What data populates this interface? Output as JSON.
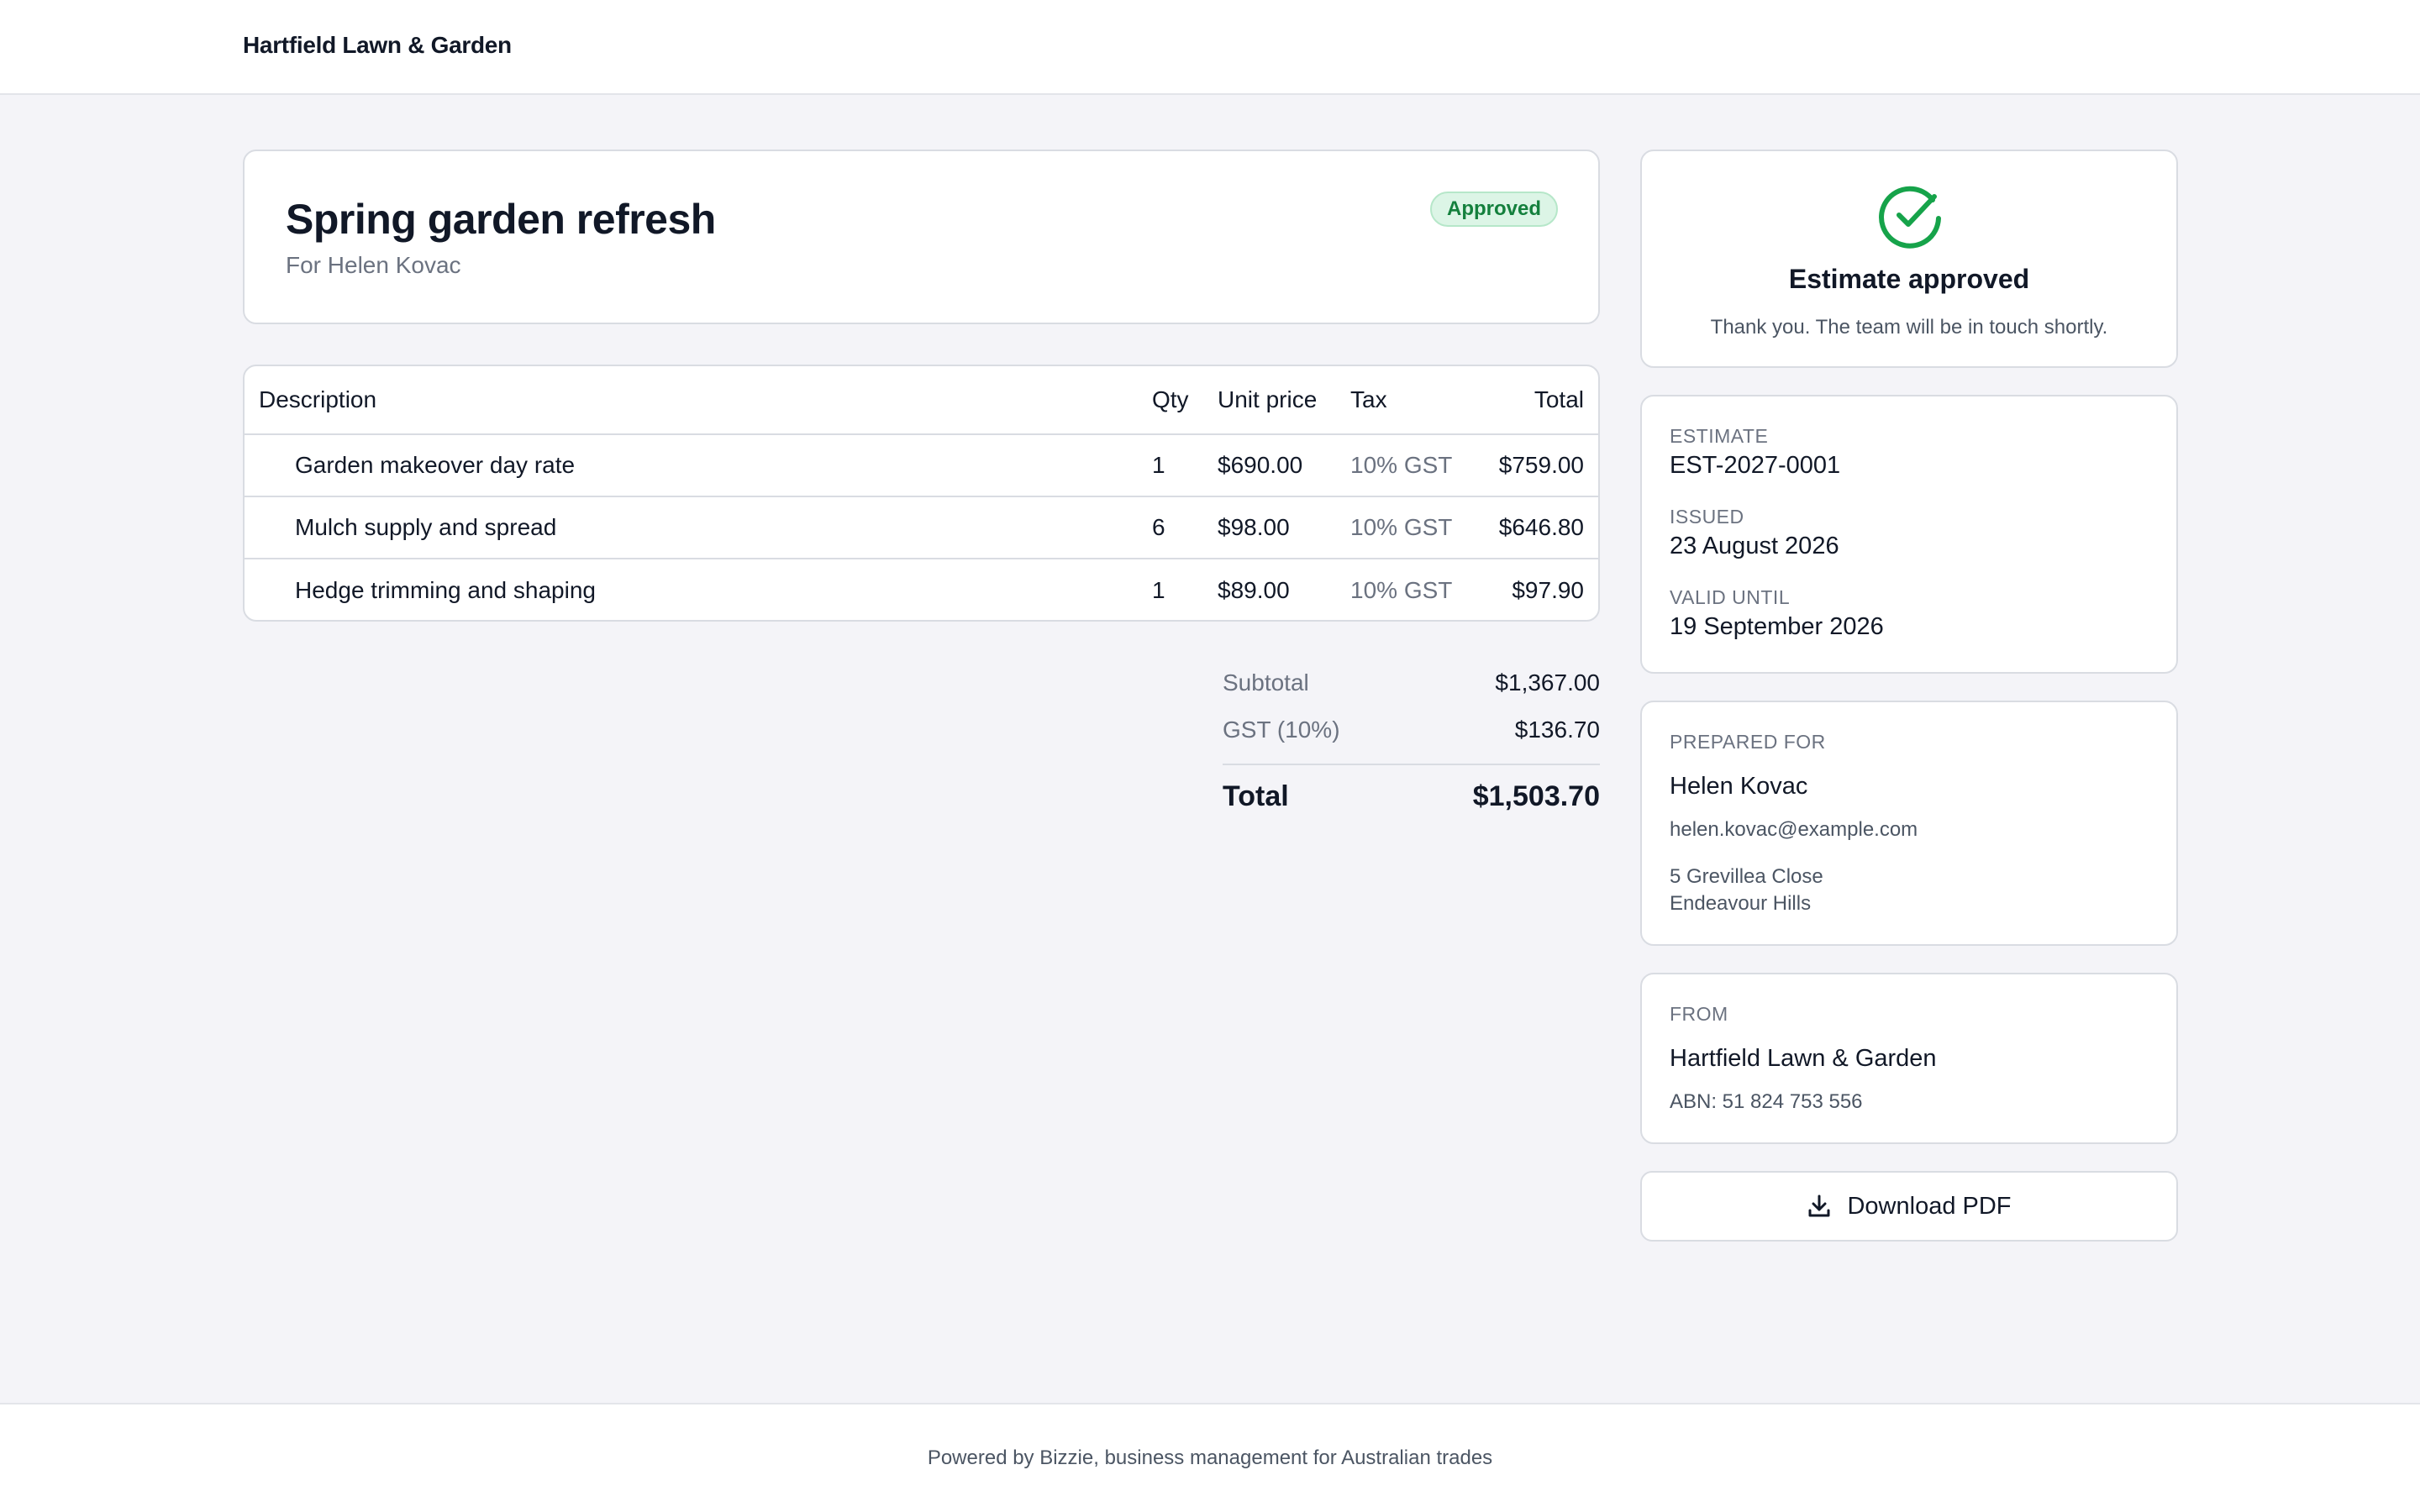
{
  "header": {
    "brand": "Hartfield Lawn & Garden"
  },
  "estimate": {
    "title": "Spring garden refresh",
    "subtitle": "For Helen Kovac",
    "status": "Approved"
  },
  "table": {
    "headers": {
      "description": "Description",
      "qty": "Qty",
      "unit_price": "Unit price",
      "tax": "Tax",
      "total": "Total"
    },
    "rows": [
      {
        "description": "Garden makeover day rate",
        "qty": "1",
        "unit_price": "$690.00",
        "tax": "10% GST",
        "total": "$759.00"
      },
      {
        "description": "Mulch supply and spread",
        "qty": "6",
        "unit_price": "$98.00",
        "tax": "10% GST",
        "total": "$646.80"
      },
      {
        "description": "Hedge trimming and shaping",
        "qty": "1",
        "unit_price": "$89.00",
        "tax": "10% GST",
        "total": "$97.90"
      }
    ]
  },
  "totals": {
    "subtotal_label": "Subtotal",
    "subtotal": "$1,367.00",
    "gst_label": "GST (10%)",
    "gst": "$136.70",
    "total_label": "Total",
    "total": "$1,503.70"
  },
  "approval": {
    "title": "Estimate approved",
    "message": "Thank you. The team will be in touch shortly.",
    "icon": "check-circle-icon",
    "color": "#16a34a"
  },
  "meta": {
    "estimate_label": "ESTIMATE",
    "estimate_number": "EST-2027-0001",
    "issued_label": "ISSUED",
    "issued": "23 August 2026",
    "valid_label": "VALID UNTIL",
    "valid_until": "19 September 2026"
  },
  "prepared_for": {
    "label": "PREPARED FOR",
    "name": "Helen Kovac",
    "email": "helen.kovac@example.com",
    "address_line1": "5 Grevillea Close",
    "address_line2": "Endeavour Hills"
  },
  "from": {
    "label": "FROM",
    "name": "Hartfield Lawn & Garden",
    "abn": "ABN: 51 824 753 556"
  },
  "actions": {
    "download_pdf": "Download PDF",
    "download_icon": "download-icon"
  },
  "footer": {
    "text": "Powered by Bizzie, business management for Australian trades"
  }
}
